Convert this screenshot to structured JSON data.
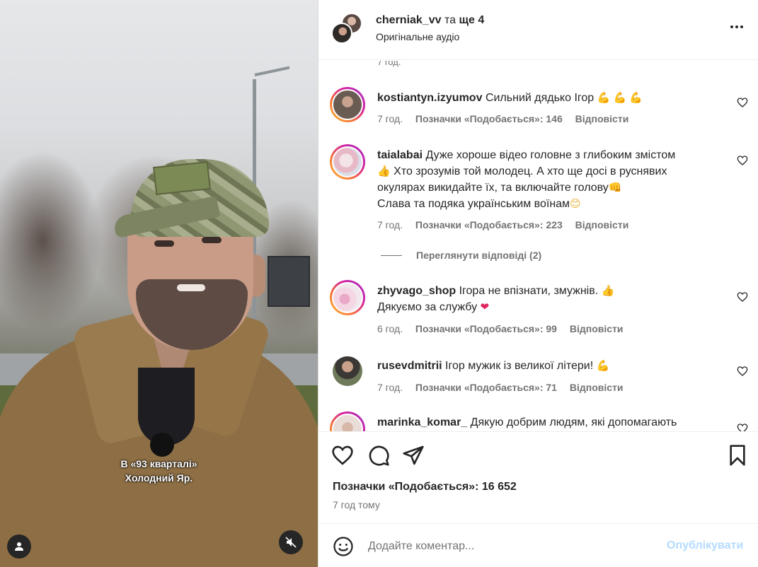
{
  "video": {
    "subtitle_line1": "В «93 кварталі»",
    "subtitle_line2": "Холодний Яр."
  },
  "header": {
    "username": "cherniak_vv",
    "and_text": "та",
    "more_link": "ще 4",
    "audio_label": "Оригінальне аудіо"
  },
  "clipped_time": "7 год.",
  "comments": [
    {
      "username": "kostiantyn.izyumov",
      "lines": [
        "Сильний дядько Ігор"
      ],
      "emoji": "💪 💪 💪",
      "time": "7 год.",
      "likes": "Позначки «Подобається»: 146",
      "reply": "Відповісти"
    },
    {
      "username": "taialabai",
      "line1": "Дуже хороше відео головне з глибоким змістом",
      "line2": "Хто зрозумів той молодец. А хто ще досі в руснявих",
      "line3": "окулярах викидайте їх, та включайте голову",
      "line4": "Слава та подяка українським воїнам",
      "time": "7 год.",
      "likes": "Позначки «Подобається»: 223",
      "reply": "Відповісти",
      "view_replies": "Переглянути відповіді (2)"
    },
    {
      "username": "zhyvago_shop",
      "line1": "Ігора не впізнати, змужнів.",
      "line2": "Дякуємо за службу",
      "time": "6 год.",
      "likes": "Позначки «Подобається»: 99",
      "reply": "Відповісти"
    },
    {
      "username": "rusevdmitrii",
      "line1": "Ігор мужик із великої літери!",
      "time": "7 год.",
      "likes": "Позначки «Подобається»: 71",
      "reply": "Відповісти"
    },
    {
      "username": "marinka_komar_",
      "line1": "Дякую добрим людям, які допомагають"
    }
  ],
  "footer": {
    "likes_count": "Позначки «Подобається»: 16 652",
    "posted_ago": "7 год тому",
    "comment_placeholder": "Додайте коментар...",
    "publish_label": "Опублікувати"
  },
  "icons": {
    "tag": "user-tag-icon",
    "mute": "speaker-muted-icon",
    "more": "more-horizontal-icon",
    "like": "heart-icon",
    "comment": "comment-icon",
    "share": "share-plane-icon",
    "save": "bookmark-icon",
    "emoji": "emoji-smile-icon"
  },
  "colors": {
    "link_disabled": "#b3dbff",
    "secondary_text": "#737373",
    "primary_text": "#262626",
    "heart_emoji": "#e0245e"
  }
}
